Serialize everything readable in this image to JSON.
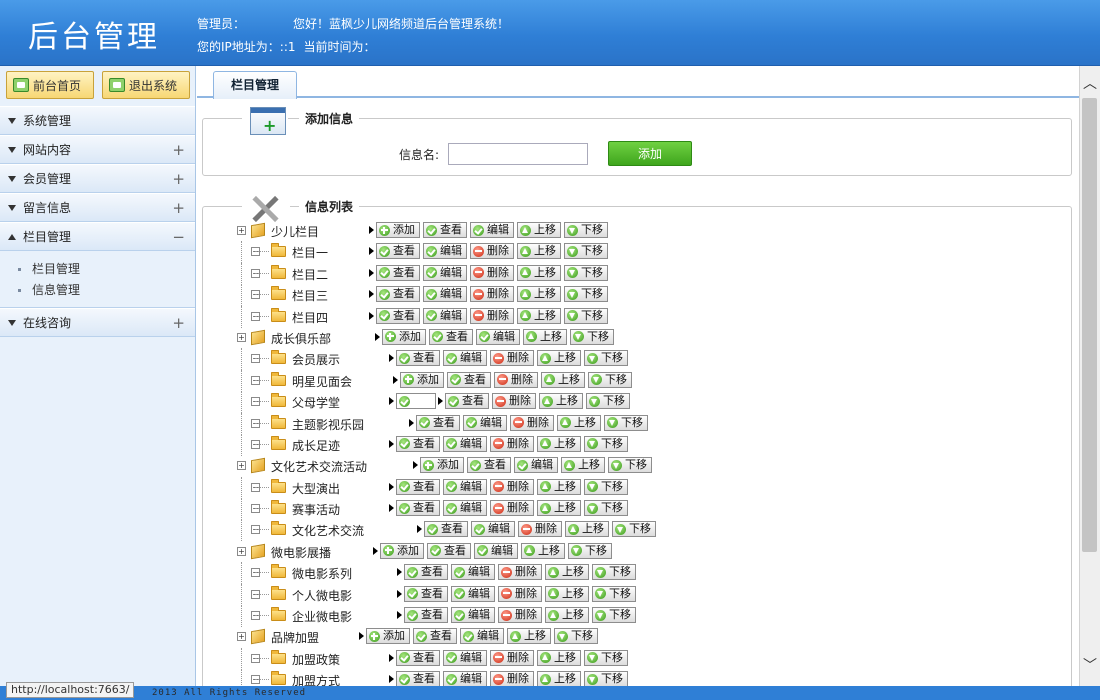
{
  "header": {
    "app_title": "后台管理",
    "admin_label": "管理员：",
    "greeting": "您好！蓝枫少儿网络频道后台管理系统！",
    "ip_label": "您的IP地址为：::1",
    "time_label": "当前时间为："
  },
  "sidebar": {
    "home_button": "前台首页",
    "logout_button": "退出系统",
    "nav": [
      {
        "label": "系统管理",
        "toggle": ""
      },
      {
        "label": "网站内容",
        "toggle": "+"
      },
      {
        "label": "会员管理",
        "toggle": "+"
      },
      {
        "label": "留言信息",
        "toggle": "+"
      },
      {
        "label": "栏目管理",
        "toggle": "−"
      },
      {
        "label": "在线咨询",
        "toggle": "+"
      }
    ],
    "sub_items": [
      "栏目管理",
      "信息管理"
    ]
  },
  "tab": {
    "label": "栏目管理"
  },
  "add_section": {
    "legend": "添加信息",
    "field_label": "信息名:",
    "input_value": "",
    "submit_label": "添加"
  },
  "list_section": {
    "legend": "信息列表"
  },
  "tree": [
    {
      "name": "少儿栏目",
      "level": 0,
      "actions": [
        "添加",
        "查看",
        "编辑",
        "上移",
        "下移"
      ]
    },
    {
      "name": "栏目一",
      "level": 1,
      "actions": [
        "查看",
        "编辑",
        "删除",
        "上移",
        "下移"
      ]
    },
    {
      "name": "栏目二",
      "level": 1,
      "actions": [
        "查看",
        "编辑",
        "删除",
        "上移",
        "下移"
      ]
    },
    {
      "name": "栏目三",
      "level": 1,
      "actions": [
        "查看",
        "编辑",
        "删除",
        "上移",
        "下移"
      ]
    },
    {
      "name": "栏目四",
      "level": 1,
      "actions": [
        "查看",
        "编辑",
        "删除",
        "上移",
        "下移"
      ]
    },
    {
      "name": "成长俱乐部",
      "level": 0,
      "actions": [
        "添加",
        "查看",
        "编辑",
        "上移",
        "下移"
      ]
    },
    {
      "name": "会员展示",
      "level": 1,
      "actions": [
        "查看",
        "编辑",
        "删除",
        "上移",
        "下移"
      ]
    },
    {
      "name": "明星见面会",
      "level": 1,
      "actions": [
        "添加",
        "查看",
        "删除",
        "上移",
        "下移"
      ]
    },
    {
      "name": "父母学堂",
      "level": 1,
      "actions": [
        "",
        "查看",
        "删除",
        "上移",
        "下移"
      ]
    },
    {
      "name": "主题影视乐园",
      "level": 1,
      "actions": [
        "查看",
        "编辑",
        "删除",
        "上移",
        "下移"
      ]
    },
    {
      "name": "成长足迹",
      "level": 1,
      "actions": [
        "查看",
        "编辑",
        "删除",
        "上移",
        "下移"
      ]
    },
    {
      "name": "文化艺术交流活动",
      "level": 0,
      "actions": [
        "添加",
        "查看",
        "编辑",
        "上移",
        "下移"
      ]
    },
    {
      "name": "大型演出",
      "level": 1,
      "actions": [
        "查看",
        "编辑",
        "删除",
        "上移",
        "下移"
      ]
    },
    {
      "name": "赛事活动",
      "level": 1,
      "actions": [
        "查看",
        "编辑",
        "删除",
        "上移",
        "下移"
      ]
    },
    {
      "name": "文化艺术交流",
      "level": 1,
      "actions": [
        "查看",
        "编辑",
        "删除",
        "上移",
        "下移"
      ]
    },
    {
      "name": "微电影展播",
      "level": 0,
      "actions": [
        "添加",
        "查看",
        "编辑",
        "上移",
        "下移"
      ]
    },
    {
      "name": "微电影系列",
      "level": 1,
      "actions": [
        "查看",
        "编辑",
        "删除",
        "上移",
        "下移"
      ]
    },
    {
      "name": "个人微电影",
      "level": 1,
      "actions": [
        "查看",
        "编辑",
        "删除",
        "上移",
        "下移"
      ]
    },
    {
      "name": "企业微电影",
      "level": 1,
      "actions": [
        "查看",
        "编辑",
        "删除",
        "上移",
        "下移"
      ]
    },
    {
      "name": "品牌加盟",
      "level": 0,
      "actions": [
        "添加",
        "查看",
        "编辑",
        "上移",
        "下移"
      ]
    },
    {
      "name": "加盟政策",
      "level": 1,
      "actions": [
        "查看",
        "编辑",
        "删除",
        "上移",
        "下移"
      ]
    },
    {
      "name": "加盟方式",
      "level": 1,
      "actions": [
        "查看",
        "编辑",
        "删除",
        "上移",
        "下移"
      ]
    }
  ],
  "status": {
    "url": "http://localhost:7663/",
    "copyright": "2013 All Rights Reserved"
  }
}
